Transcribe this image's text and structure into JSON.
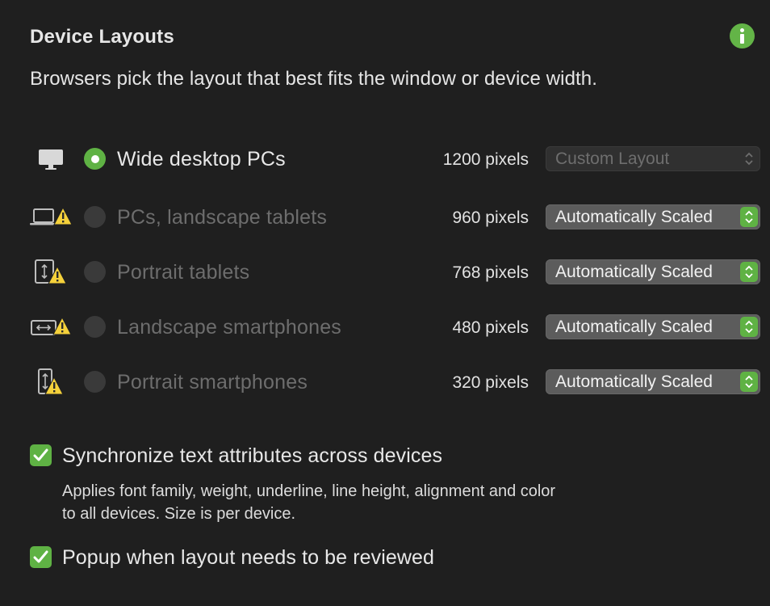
{
  "header": {
    "title": "Device Layouts",
    "subtitle": "Browsers pick the layout that best fits the window or device width."
  },
  "devices": [
    {
      "label": "Wide desktop PCs",
      "pixels": "1200 pixels",
      "layout": "Custom Layout",
      "selected": true,
      "warning": false,
      "icon": "desktop-icon"
    },
    {
      "label": "PCs, landscape tablets",
      "pixels": "960 pixels",
      "layout": "Automatically Scaled",
      "selected": false,
      "warning": true,
      "icon": "laptop-warning-icon"
    },
    {
      "label": "Portrait tablets",
      "pixels": "768 pixels",
      "layout": "Automatically Scaled",
      "selected": false,
      "warning": true,
      "icon": "portrait-tablet-warning-icon"
    },
    {
      "label": "Landscape smartphones",
      "pixels": "480 pixels",
      "layout": "Automatically Scaled",
      "selected": false,
      "warning": true,
      "icon": "landscape-phone-warning-icon"
    },
    {
      "label": "Portrait smartphones",
      "pixels": "320 pixels",
      "layout": "Automatically Scaled",
      "selected": false,
      "warning": true,
      "icon": "portrait-phone-warning-icon"
    }
  ],
  "options": {
    "sync_label": "Synchronize text attributes across devices",
    "sync_desc_1": "Applies font family, weight, underline, line height, alignment and color",
    "sync_desc_2": "to all devices. Size is per device.",
    "popup_label": "Popup when layout needs to be reviewed"
  },
  "colors": {
    "accent": "#5fb244",
    "background": "#1f1f1f",
    "warning": "#f5d13b"
  }
}
